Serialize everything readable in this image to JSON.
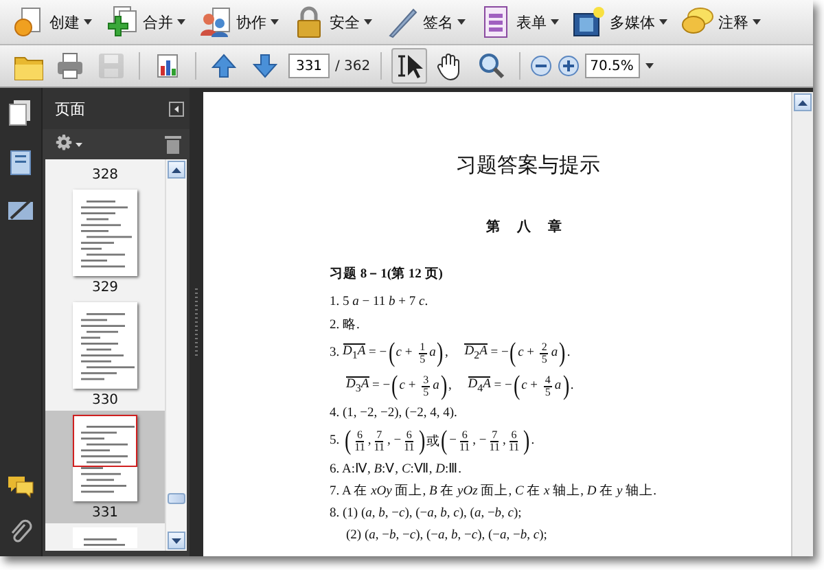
{
  "task_toolbar": [
    {
      "kind": "create",
      "label": "创建"
    },
    {
      "kind": "combine",
      "label": "合并"
    },
    {
      "kind": "collaborate",
      "label": "协作"
    },
    {
      "kind": "secure",
      "label": "安全"
    },
    {
      "kind": "sign",
      "label": "签名"
    },
    {
      "kind": "forms",
      "label": "表单"
    },
    {
      "kind": "multimedia",
      "label": "多媒体"
    },
    {
      "kind": "comment",
      "label": "注释"
    }
  ],
  "file_buttons": [
    {
      "kind": "open",
      "disabled": false
    },
    {
      "kind": "print",
      "disabled": false
    },
    {
      "kind": "save",
      "disabled": true
    },
    {
      "kind": "chart",
      "disabled": false
    }
  ],
  "navigation": {
    "page": "331",
    "total": "/ 362"
  },
  "tools": [
    {
      "kind": "select",
      "selected": true
    },
    {
      "kind": "hand",
      "selected": false
    },
    {
      "kind": "loupe",
      "selected": false
    }
  ],
  "zoom": {
    "value": "70.5%"
  },
  "pages_panel": {
    "title": "页面",
    "thumbnails": [
      {
        "label": "328",
        "selected": false,
        "partial": true
      },
      {
        "label": "329",
        "selected": false
      },
      {
        "label": "330",
        "selected": false
      },
      {
        "label": "331",
        "selected": true
      }
    ]
  },
  "document": {
    "title": "习题答案与提示",
    "chapter": "第 八 章",
    "section": "习题 8－1(第 12 页)",
    "lines": [
      {
        "parts": [
          {
            "kind": "text",
            "text": "1. 5 *a* − 11 *b* + 7 *c*."
          }
        ]
      },
      {
        "parts": [
          {
            "kind": "text",
            "text": "2. 略."
          }
        ]
      },
      {
        "parts": [
          {
            "kind": "text",
            "text": "3. "
          },
          {
            "kind": "vec",
            "text": "*D*$_{1}$*A*"
          },
          {
            "kind": "text",
            "text": " = −"
          },
          {
            "kind": "big",
            "text": "("
          },
          {
            "kind": "text",
            "text": "*c* + "
          },
          {
            "kind": "frac",
            "num": "1",
            "den": "5"
          },
          {
            "kind": "text",
            "text": "*a*"
          },
          {
            "kind": "big",
            "text": ")"
          },
          {
            "kind": "text",
            "text": ",     "
          },
          {
            "kind": "vec",
            "text": "*D*$_{2}$*A*"
          },
          {
            "kind": "text",
            "text": " = −"
          },
          {
            "kind": "big",
            "text": "("
          },
          {
            "kind": "text",
            "text": "*c* + "
          },
          {
            "kind": "frac",
            "num": "2",
            "den": "5"
          },
          {
            "kind": "text",
            "text": "*a*"
          },
          {
            "kind": "big",
            "text": ")"
          },
          {
            "kind": "text",
            "text": "."
          }
        ]
      },
      {
        "continuation": true,
        "parts": [
          {
            "kind": "vec",
            "text": "*D*$_{3}$*A*"
          },
          {
            "kind": "text",
            "text": " = −"
          },
          {
            "kind": "big",
            "text": "("
          },
          {
            "kind": "text",
            "text": "*c* + "
          },
          {
            "kind": "frac",
            "num": "3",
            "den": "5"
          },
          {
            "kind": "text",
            "text": "*a*"
          },
          {
            "kind": "big",
            "text": ")"
          },
          {
            "kind": "text",
            "text": ",     "
          },
          {
            "kind": "vec",
            "text": "*D*$_{4}$*A*"
          },
          {
            "kind": "text",
            "text": " = −"
          },
          {
            "kind": "big",
            "text": "("
          },
          {
            "kind": "text",
            "text": "*c* + "
          },
          {
            "kind": "frac",
            "num": "4",
            "den": "5"
          },
          {
            "kind": "text",
            "text": "*a*"
          },
          {
            "kind": "big",
            "text": ")"
          },
          {
            "kind": "text",
            "text": "."
          }
        ]
      },
      {
        "parts": [
          {
            "kind": "text",
            "text": "4. (1, −2, −2), (−2, 4, 4)."
          }
        ]
      },
      {
        "parts": [
          {
            "kind": "text",
            "text": "5. "
          },
          {
            "kind": "big",
            "text": "("
          },
          {
            "kind": "frac",
            "num": "6",
            "den": "11"
          },
          {
            "kind": "text",
            "text": ","
          },
          {
            "kind": "frac",
            "num": "7",
            "den": "11"
          },
          {
            "kind": "text",
            "text": ", −"
          },
          {
            "kind": "frac",
            "num": "6",
            "den": "11"
          },
          {
            "kind": "big",
            "text": ")"
          },
          {
            "kind": "text",
            "text": "或"
          },
          {
            "kind": "big",
            "text": "("
          },
          {
            "kind": "text",
            "text": "−"
          },
          {
            "kind": "frac",
            "num": "6",
            "den": "11"
          },
          {
            "kind": "text",
            "text": ", −"
          },
          {
            "kind": "frac",
            "num": "7",
            "den": "11"
          },
          {
            "kind": "text",
            "text": ","
          },
          {
            "kind": "frac",
            "num": "6",
            "den": "11"
          },
          {
            "kind": "big",
            "text": ")"
          },
          {
            "kind": "text",
            "text": "."
          }
        ]
      },
      {
        "parts": [
          {
            "kind": "text",
            "text": "6. A:Ⅳ, *B*:Ⅴ, *C*:Ⅶ, *D*:Ⅲ."
          }
        ]
      },
      {
        "parts": [
          {
            "kind": "text",
            "text": "7. A 在 *xOy* 面上, *B* 在 *yOz* 面上, *C* 在 *x* 轴上, *D* 在 *y* 轴上."
          }
        ]
      },
      {
        "parts": [
          {
            "kind": "text",
            "text": "8. (1) (*a*, *b*, −*c*), (−*a*, *b*, *c*), (*a*, −*b*, *c*);"
          }
        ]
      },
      {
        "continuation": true,
        "parts": [
          {
            "kind": "text",
            "text": "(2) (*a*, −*b*, −*c*), (−*a*, *b*, −*c*), (−*a*, −*b*, *c*);"
          }
        ]
      }
    ]
  }
}
